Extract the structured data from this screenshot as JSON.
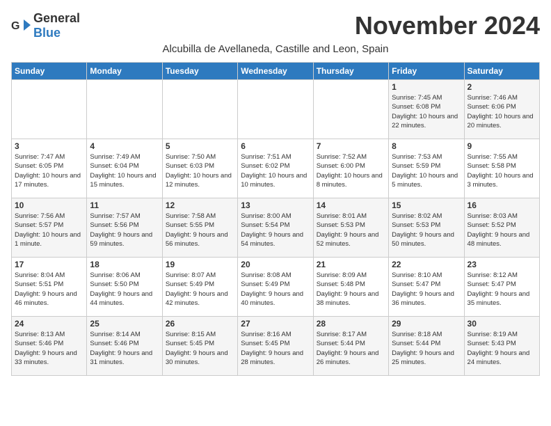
{
  "header": {
    "logo_general": "General",
    "logo_blue": "Blue",
    "month_year": "November 2024",
    "subtitle": "Alcubilla de Avellaneda, Castille and Leon, Spain"
  },
  "days_of_week": [
    "Sunday",
    "Monday",
    "Tuesday",
    "Wednesday",
    "Thursday",
    "Friday",
    "Saturday"
  ],
  "weeks": [
    [
      {
        "day": "",
        "info": ""
      },
      {
        "day": "",
        "info": ""
      },
      {
        "day": "",
        "info": ""
      },
      {
        "day": "",
        "info": ""
      },
      {
        "day": "",
        "info": ""
      },
      {
        "day": "1",
        "info": "Sunrise: 7:45 AM\nSunset: 6:08 PM\nDaylight: 10 hours and 22 minutes."
      },
      {
        "day": "2",
        "info": "Sunrise: 7:46 AM\nSunset: 6:06 PM\nDaylight: 10 hours and 20 minutes."
      }
    ],
    [
      {
        "day": "3",
        "info": "Sunrise: 7:47 AM\nSunset: 6:05 PM\nDaylight: 10 hours and 17 minutes."
      },
      {
        "day": "4",
        "info": "Sunrise: 7:49 AM\nSunset: 6:04 PM\nDaylight: 10 hours and 15 minutes."
      },
      {
        "day": "5",
        "info": "Sunrise: 7:50 AM\nSunset: 6:03 PM\nDaylight: 10 hours and 12 minutes."
      },
      {
        "day": "6",
        "info": "Sunrise: 7:51 AM\nSunset: 6:02 PM\nDaylight: 10 hours and 10 minutes."
      },
      {
        "day": "7",
        "info": "Sunrise: 7:52 AM\nSunset: 6:00 PM\nDaylight: 10 hours and 8 minutes."
      },
      {
        "day": "8",
        "info": "Sunrise: 7:53 AM\nSunset: 5:59 PM\nDaylight: 10 hours and 5 minutes."
      },
      {
        "day": "9",
        "info": "Sunrise: 7:55 AM\nSunset: 5:58 PM\nDaylight: 10 hours and 3 minutes."
      }
    ],
    [
      {
        "day": "10",
        "info": "Sunrise: 7:56 AM\nSunset: 5:57 PM\nDaylight: 10 hours and 1 minute."
      },
      {
        "day": "11",
        "info": "Sunrise: 7:57 AM\nSunset: 5:56 PM\nDaylight: 9 hours and 59 minutes."
      },
      {
        "day": "12",
        "info": "Sunrise: 7:58 AM\nSunset: 5:55 PM\nDaylight: 9 hours and 56 minutes."
      },
      {
        "day": "13",
        "info": "Sunrise: 8:00 AM\nSunset: 5:54 PM\nDaylight: 9 hours and 54 minutes."
      },
      {
        "day": "14",
        "info": "Sunrise: 8:01 AM\nSunset: 5:53 PM\nDaylight: 9 hours and 52 minutes."
      },
      {
        "day": "15",
        "info": "Sunrise: 8:02 AM\nSunset: 5:53 PM\nDaylight: 9 hours and 50 minutes."
      },
      {
        "day": "16",
        "info": "Sunrise: 8:03 AM\nSunset: 5:52 PM\nDaylight: 9 hours and 48 minutes."
      }
    ],
    [
      {
        "day": "17",
        "info": "Sunrise: 8:04 AM\nSunset: 5:51 PM\nDaylight: 9 hours and 46 minutes."
      },
      {
        "day": "18",
        "info": "Sunrise: 8:06 AM\nSunset: 5:50 PM\nDaylight: 9 hours and 44 minutes."
      },
      {
        "day": "19",
        "info": "Sunrise: 8:07 AM\nSunset: 5:49 PM\nDaylight: 9 hours and 42 minutes."
      },
      {
        "day": "20",
        "info": "Sunrise: 8:08 AM\nSunset: 5:49 PM\nDaylight: 9 hours and 40 minutes."
      },
      {
        "day": "21",
        "info": "Sunrise: 8:09 AM\nSunset: 5:48 PM\nDaylight: 9 hours and 38 minutes."
      },
      {
        "day": "22",
        "info": "Sunrise: 8:10 AM\nSunset: 5:47 PM\nDaylight: 9 hours and 36 minutes."
      },
      {
        "day": "23",
        "info": "Sunrise: 8:12 AM\nSunset: 5:47 PM\nDaylight: 9 hours and 35 minutes."
      }
    ],
    [
      {
        "day": "24",
        "info": "Sunrise: 8:13 AM\nSunset: 5:46 PM\nDaylight: 9 hours and 33 minutes."
      },
      {
        "day": "25",
        "info": "Sunrise: 8:14 AM\nSunset: 5:46 PM\nDaylight: 9 hours and 31 minutes."
      },
      {
        "day": "26",
        "info": "Sunrise: 8:15 AM\nSunset: 5:45 PM\nDaylight: 9 hours and 30 minutes."
      },
      {
        "day": "27",
        "info": "Sunrise: 8:16 AM\nSunset: 5:45 PM\nDaylight: 9 hours and 28 minutes."
      },
      {
        "day": "28",
        "info": "Sunrise: 8:17 AM\nSunset: 5:44 PM\nDaylight: 9 hours and 26 minutes."
      },
      {
        "day": "29",
        "info": "Sunrise: 8:18 AM\nSunset: 5:44 PM\nDaylight: 9 hours and 25 minutes."
      },
      {
        "day": "30",
        "info": "Sunrise: 8:19 AM\nSunset: 5:43 PM\nDaylight: 9 hours and 24 minutes."
      }
    ]
  ]
}
